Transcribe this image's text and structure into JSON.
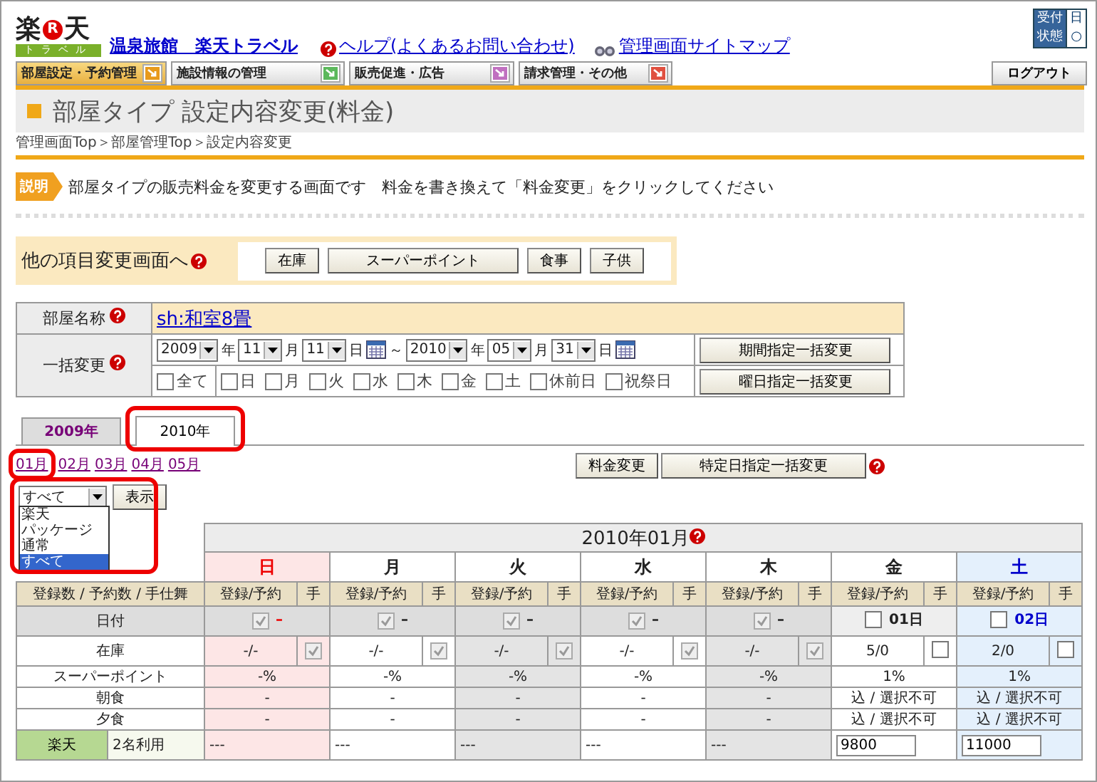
{
  "logo": {
    "left": "楽",
    "badge": "R",
    "right": "天",
    "sub": "トラベル"
  },
  "header_links": [
    {
      "kind": "hotel",
      "label": "温泉旅館　楽天トラベル"
    },
    {
      "kind": "help",
      "label": "ヘルプ(よくあるお問い合わせ)"
    },
    {
      "kind": "sitemap",
      "label": "管理画面サイトマップ"
    }
  ],
  "status_box": [
    {
      "label": "受付",
      "value": "日"
    },
    {
      "label": "状態",
      "value": "○"
    }
  ],
  "nav": [
    {
      "label": "部屋設定・予約管理",
      "selected": true,
      "color": "#e89a1c"
    },
    {
      "label": "施設情報の管理",
      "selected": false,
      "color": "#5cb85c"
    },
    {
      "label": "販売促進・広告",
      "selected": false,
      "color": "#c070c0"
    },
    {
      "label": "請求管理・その他",
      "selected": false,
      "color": "#e05040"
    }
  ],
  "logout": "ログアウト",
  "page_title": "部屋タイプ 設定内容変更(料金)",
  "breadcrumb": "管理画面Top＞部屋管理Top＞設定内容変更",
  "description": {
    "badge": "説明",
    "text": "部屋タイプの販売料金を変更する画面です　料金を書き換えて「料金変更」をクリックしてください"
  },
  "other_screens": {
    "label": "他の項目変更画面へ",
    "buttons": [
      "在庫",
      "スーパーポイント",
      "食事",
      "子供"
    ]
  },
  "room": {
    "name_label": "部屋名称",
    "name": "sh:和室8畳",
    "bulk_label": "一括変更",
    "range": [
      {
        "kind": "select",
        "value": "2009"
      },
      {
        "kind": "unit",
        "text": "年"
      },
      {
        "kind": "select",
        "value": "11"
      },
      {
        "kind": "unit",
        "text": "月"
      },
      {
        "kind": "select",
        "value": "11"
      },
      {
        "kind": "unit",
        "text": "日"
      },
      {
        "kind": "calendar"
      },
      {
        "kind": "unit",
        "text": "～"
      },
      {
        "kind": "select",
        "value": "2010"
      },
      {
        "kind": "unit",
        "text": "年"
      },
      {
        "kind": "select",
        "value": "05"
      },
      {
        "kind": "unit",
        "text": "月"
      },
      {
        "kind": "select",
        "value": "31"
      },
      {
        "kind": "unit",
        "text": "日"
      },
      {
        "kind": "calendar"
      }
    ],
    "period_button": "期間指定一括変更",
    "day_checks": [
      {
        "kind": "all",
        "label": "全て",
        "checked": false
      },
      {
        "kind": "day",
        "label": "日",
        "checked": false
      },
      {
        "kind": "day",
        "label": "月",
        "checked": false
      },
      {
        "kind": "day",
        "label": "火",
        "checked": false
      },
      {
        "kind": "day",
        "label": "水",
        "checked": false
      },
      {
        "kind": "day",
        "label": "木",
        "checked": false
      },
      {
        "kind": "day",
        "label": "金",
        "checked": false
      },
      {
        "kind": "day",
        "label": "土",
        "checked": false
      },
      {
        "kind": "day",
        "label": "休前日",
        "checked": false
      },
      {
        "kind": "day",
        "label": "祝祭日",
        "checked": false
      }
    ],
    "weekday_button": "曜日指定一括変更"
  },
  "year_tabs": [
    {
      "label": "2009年",
      "selected": false
    },
    {
      "label": "2010年",
      "selected": true
    }
  ],
  "months": [
    "01月",
    "02月",
    "03月",
    "04月",
    "05月"
  ],
  "actions": [
    "料金変更",
    "特定日指定一括変更"
  ],
  "filter": {
    "value": "すべて",
    "button": "表示",
    "options": [
      {
        "label": "楽天",
        "selected": false
      },
      {
        "label": "パッケージ",
        "selected": false
      },
      {
        "label": "通常",
        "selected": false
      },
      {
        "label": "すべて",
        "selected": true
      }
    ]
  },
  "calendar": {
    "title": "2010年01月",
    "row_header": "登録数 / 予約数 / 手仕舞",
    "row_labels": [
      "日付",
      "在庫",
      "スーパーポイント",
      "朝食",
      "夕食"
    ],
    "plan": {
      "name": "楽天",
      "people": "2名利用"
    },
    "days": [
      {
        "weekday": "日",
        "kind": "sun",
        "shaded": false,
        "sub_left": "登録/予約",
        "sub_right": "手",
        "date_checked": true,
        "date_disabled": true,
        "date_label": "–",
        "stock": "-/-",
        "stock_checked": true,
        "stock_disabled": true,
        "point": "-%",
        "breakfast": "-",
        "dinner": "-",
        "price": {
          "kind": "text",
          "value": "---"
        }
      },
      {
        "weekday": "月",
        "kind": "weekday",
        "shaded": false,
        "sub_left": "登録/予約",
        "sub_right": "手",
        "date_checked": true,
        "date_disabled": true,
        "date_label": "–",
        "stock": "-/-",
        "stock_checked": true,
        "stock_disabled": true,
        "point": "-%",
        "breakfast": "-",
        "dinner": "-",
        "price": {
          "kind": "text",
          "value": "---"
        }
      },
      {
        "weekday": "火",
        "kind": "weekday",
        "shaded": true,
        "sub_left": "登録/予約",
        "sub_right": "手",
        "date_checked": true,
        "date_disabled": true,
        "date_label": "–",
        "stock": "-/-",
        "stock_checked": true,
        "stock_disabled": true,
        "point": "-%",
        "breakfast": "-",
        "dinner": "-",
        "price": {
          "kind": "text",
          "value": "---"
        }
      },
      {
        "weekday": "水",
        "kind": "weekday",
        "shaded": false,
        "sub_left": "登録/予約",
        "sub_right": "手",
        "date_checked": true,
        "date_disabled": true,
        "date_label": "–",
        "stock": "-/-",
        "stock_checked": true,
        "stock_disabled": true,
        "point": "-%",
        "breakfast": "-",
        "dinner": "-",
        "price": {
          "kind": "text",
          "value": "---"
        }
      },
      {
        "weekday": "木",
        "kind": "weekday",
        "shaded": true,
        "sub_left": "登録/予約",
        "sub_right": "手",
        "date_checked": true,
        "date_disabled": true,
        "date_label": "–",
        "stock": "-/-",
        "stock_checked": true,
        "stock_disabled": true,
        "point": "-%",
        "breakfast": "-",
        "dinner": "-",
        "price": {
          "kind": "text",
          "value": "---"
        }
      },
      {
        "weekday": "金",
        "kind": "weekday",
        "shaded": false,
        "sub_left": "登録/予約",
        "sub_right": "手",
        "date_checked": false,
        "date_disabled": false,
        "date_label": "01日",
        "stock": "5/0",
        "stock_checked": false,
        "stock_disabled": false,
        "point": "1%",
        "breakfast": "込 / 選択不可",
        "dinner": "込 / 選択不可",
        "price": {
          "kind": "input",
          "value": "9800"
        }
      },
      {
        "weekday": "土",
        "kind": "sat",
        "shaded": false,
        "sub_left": "登録/予約",
        "sub_right": "手",
        "date_checked": false,
        "date_disabled": false,
        "date_label": "02日",
        "stock": "2/0",
        "stock_checked": false,
        "stock_disabled": false,
        "point": "1%",
        "breakfast": "込 / 選択不可",
        "dinner": "込 / 選択不可",
        "price": {
          "kind": "input",
          "value": "11000"
        }
      }
    ]
  }
}
